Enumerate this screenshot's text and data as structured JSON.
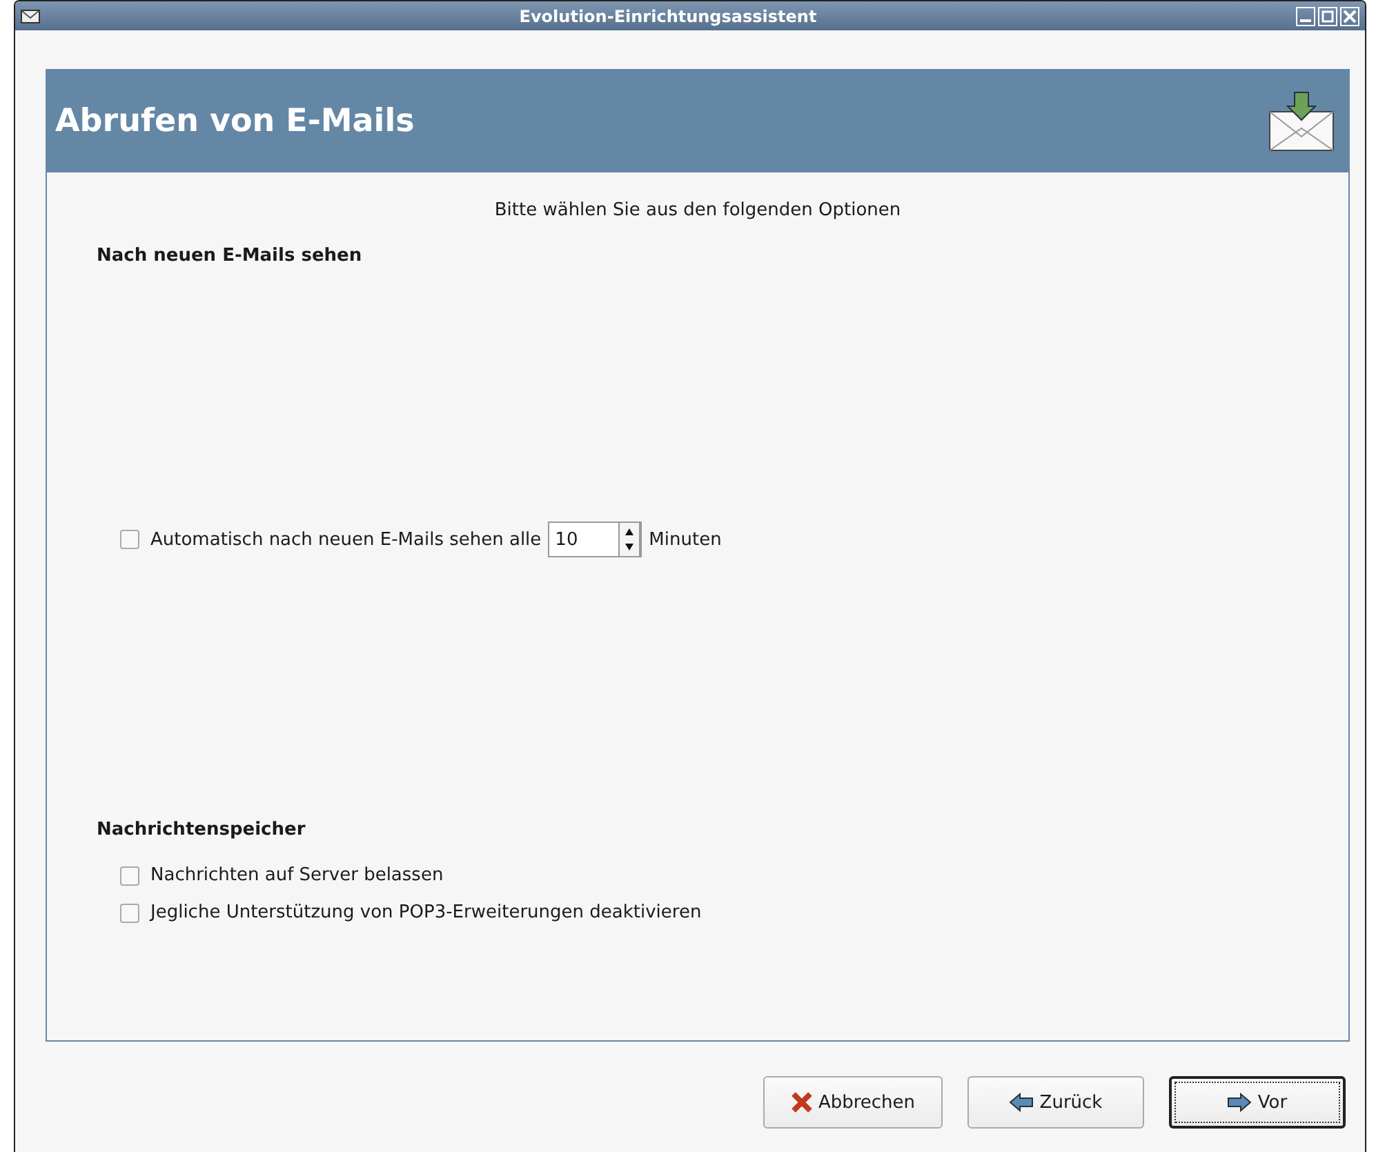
{
  "window": {
    "title": "Evolution-Einrichtungsassistent"
  },
  "header": {
    "title": "Abrufen von E-Mails"
  },
  "intro": "Bitte wählen Sie aus den folgenden Optionen",
  "check_section": {
    "heading": "Nach neuen E-Mails sehen",
    "auto_check": {
      "label": "Automatisch nach neuen E-Mails sehen alle",
      "checked": false,
      "value": "10",
      "unit": "Minuten"
    }
  },
  "storage_section": {
    "heading": "Nachrichtenspeicher",
    "options": [
      {
        "label": "Nachrichten auf Server belassen",
        "checked": false
      },
      {
        "label": "Jegliche Unterstützung von POP3-Erweiterungen deaktivieren",
        "checked": false
      }
    ]
  },
  "buttons": [
    {
      "label": "Abbrechen",
      "kind": "cancel",
      "focused": false
    },
    {
      "label": "Zurück",
      "kind": "back",
      "focused": false
    },
    {
      "label": "Vor",
      "kind": "forward",
      "focused": true
    }
  ]
}
